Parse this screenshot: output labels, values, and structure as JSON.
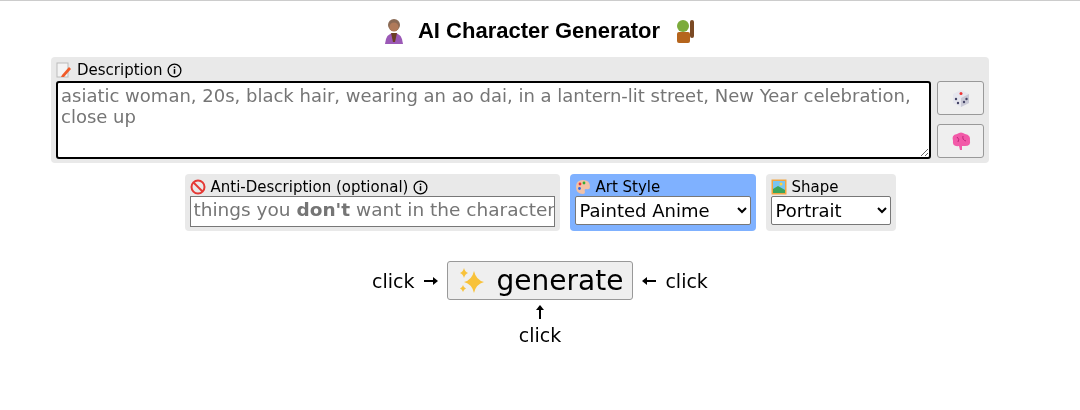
{
  "title": "AI Character Generator",
  "description": {
    "label": "Description",
    "placeholder": "asiatic woman, 20s, black hair, wearing an ao dai, in a lantern-lit street, New Year celebration, close up"
  },
  "anti_description": {
    "label": "Anti-Description (optional)",
    "placeholder": "things you **don't** want in the character"
  },
  "art_style": {
    "label": "Art Style",
    "value": "Painted Anime",
    "highlighted": true
  },
  "shape": {
    "label": "Shape",
    "value": "Portrait",
    "highlighted": false
  },
  "generate_button": {
    "label": "generate"
  },
  "hints": [
    {
      "text": "click",
      "kind": "left"
    },
    {
      "text": "click",
      "kind": "right"
    },
    {
      "text": "click",
      "kind": "below"
    }
  ]
}
